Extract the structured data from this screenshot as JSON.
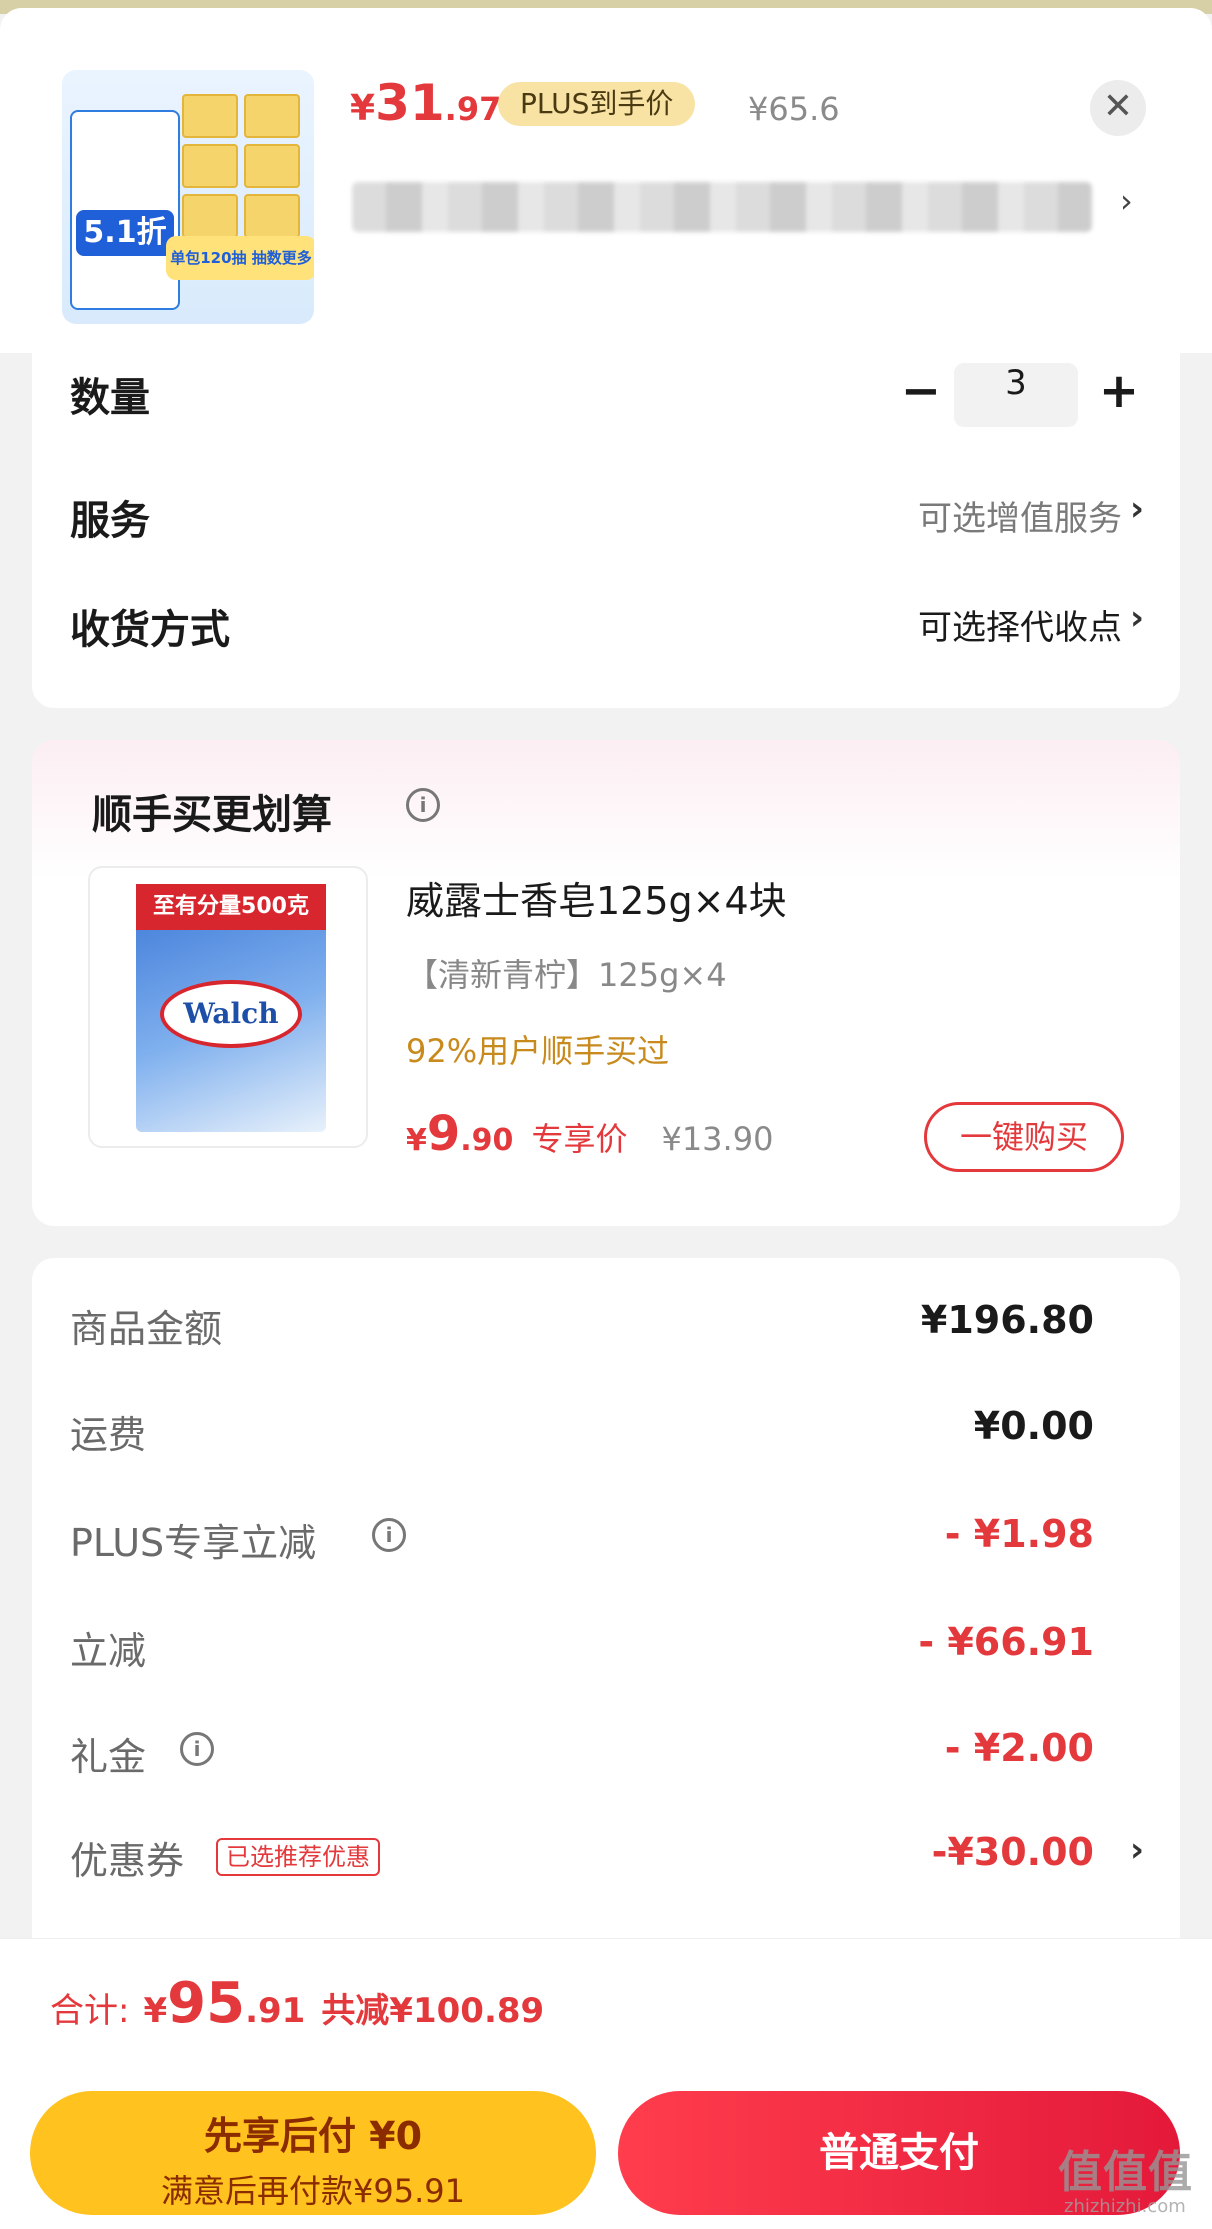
{
  "header": {
    "price_symbol": "¥",
    "price_int": "31",
    "price_dec": ".97",
    "plus_tag": "PLUS到手价",
    "orig_price": "¥65.6",
    "close_icon": "close-icon",
    "thumb_badge": "5.1折",
    "thumb_band": "单包120抽 抽数更多"
  },
  "options": {
    "quantity_label": "数量",
    "quantity_value": "3",
    "minus": "−",
    "plus": "+",
    "service_label": "服务",
    "service_value": "可选增值服务",
    "delivery_label": "收货方式",
    "delivery_value": "可选择代收点",
    "chevron": "›"
  },
  "addon": {
    "title": "顺手买更划算",
    "info_icon": "i",
    "product_name": "威露士香皂125g×4块",
    "product_spec": "【清新青柠】125g×4",
    "hint": "92%用户顺手买过",
    "price_symbol": "¥",
    "price_int": "9",
    "price_dec": ".90",
    "price_tag": "专享价",
    "old_price": "¥13.90",
    "buy_button": "一键购买",
    "box_top": "至有分量500克",
    "logo": "Walch"
  },
  "summary": {
    "rows": [
      {
        "label": "商品金额",
        "value": "¥196.80"
      },
      {
        "label": "运费",
        "value": "¥0.00"
      },
      {
        "label": "PLUS专享立减",
        "value": "- ¥1.98"
      },
      {
        "label": "立减",
        "value": "- ¥66.91"
      },
      {
        "label": "礼金",
        "value": "- ¥2.00"
      },
      {
        "label": "优惠券",
        "value": "-¥30.00"
      }
    ],
    "coupon_tag": "已选推荐优惠",
    "info_icon": "i",
    "chevron": "›"
  },
  "footer": {
    "total_label": "合计:",
    "total_symbol": "¥",
    "total_int": "95",
    "total_dec": ".91",
    "saved": "共减¥100.89",
    "later_line1": "先享后付 ¥0",
    "later_line2": "满意后再付款¥95.91",
    "pay_button": "普通支付"
  },
  "watermark": {
    "main": "值值值",
    "sub": "zhizhizhi.com"
  },
  "colors": {
    "accent_red": "#e4393c",
    "plus_gold": "#f8e2a4",
    "later_yellow": "#ffc21e"
  }
}
